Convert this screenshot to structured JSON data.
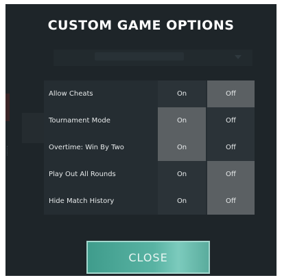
{
  "dialog": {
    "title": "CUSTOM GAME OPTIONS",
    "close_label": "CLOSE"
  },
  "options": [
    {
      "label": "Allow Cheats",
      "on_label": "On",
      "off_label": "Off",
      "selected": "Off"
    },
    {
      "label": "Tournament Mode",
      "on_label": "On",
      "off_label": "Off",
      "selected": "On"
    },
    {
      "label": "Overtime: Win By Two",
      "on_label": "On",
      "off_label": "Off",
      "selected": "On"
    },
    {
      "label": "Play Out All Rounds",
      "on_label": "On",
      "off_label": "Off",
      "selected": "Off"
    },
    {
      "label": "Hide Match History",
      "on_label": "On",
      "off_label": "Off",
      "selected": "Off"
    }
  ],
  "colors": {
    "background": "#1e2529",
    "row": "#252d32",
    "option": "#2b3338",
    "option_selected": "#5b6063",
    "close_button": "#59b3a3"
  }
}
